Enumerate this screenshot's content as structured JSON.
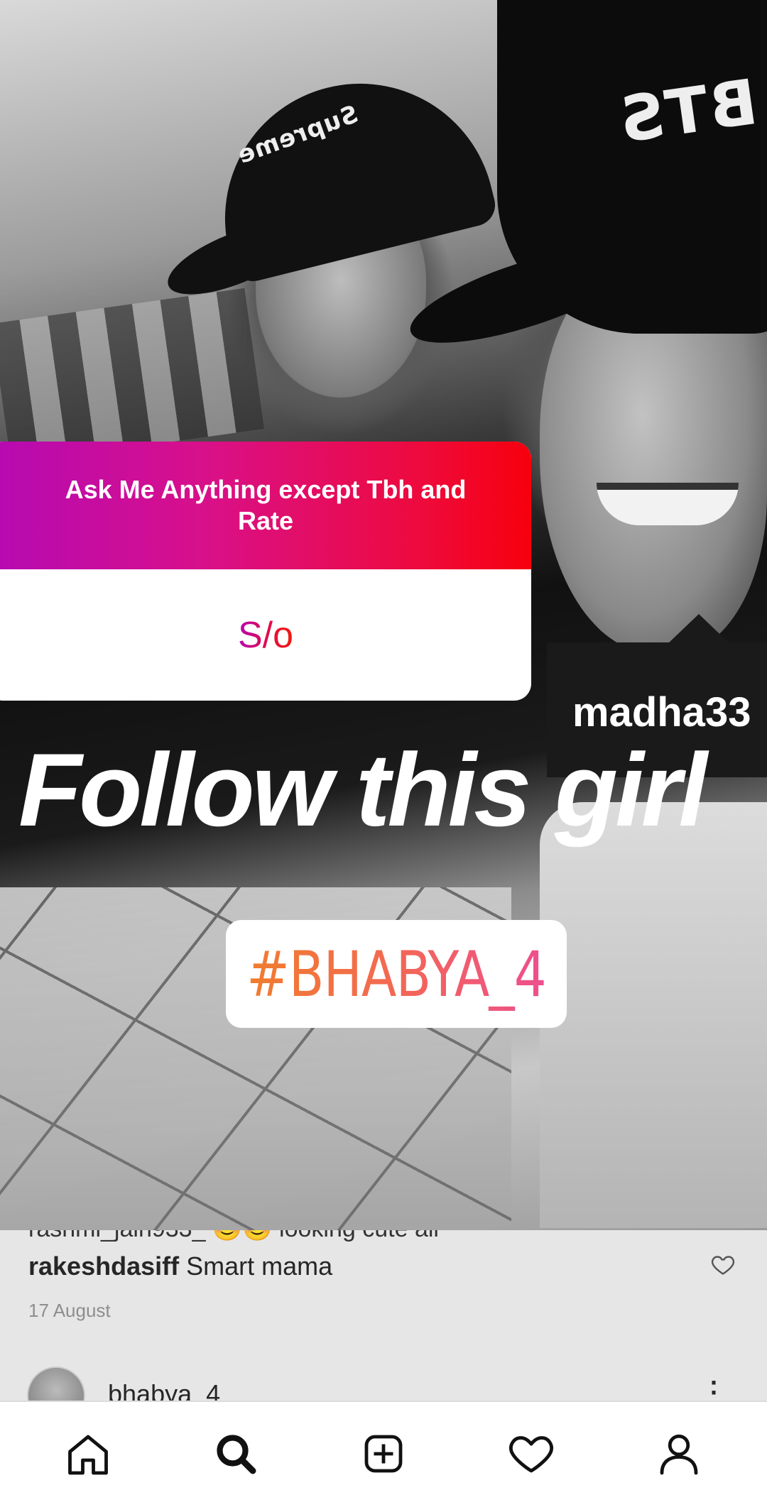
{
  "story": {
    "cap_left_text": "Supreme",
    "cap_right_text": "BTS",
    "question_sticker": {
      "prompt": "Ask Me Anything except Tbh and Rate",
      "answer": "S/o"
    },
    "mention": "madha33",
    "caption": "Follow this girl",
    "hashtag": "#BHABYA_4"
  },
  "comments": {
    "cut_off_text": "rashmi_jain933_ 😊😊 looking cute all",
    "items": [
      {
        "username": "rakeshdasiff",
        "text": "Smart mama",
        "date": "17 August"
      }
    ]
  },
  "post": {
    "username": "bhabya_4"
  },
  "nav": {
    "items": [
      {
        "icon": "home-icon"
      },
      {
        "icon": "search-icon",
        "active": true
      },
      {
        "icon": "add-post-icon"
      },
      {
        "icon": "heart-icon"
      },
      {
        "icon": "profile-icon"
      }
    ]
  },
  "colors": {
    "sticker_gradient_start": "#b40ab4",
    "sticker_gradient_end": "#f7000d",
    "hashtag_gradient_start": "#f07d2e",
    "hashtag_gradient_end": "#ee4e8f"
  }
}
